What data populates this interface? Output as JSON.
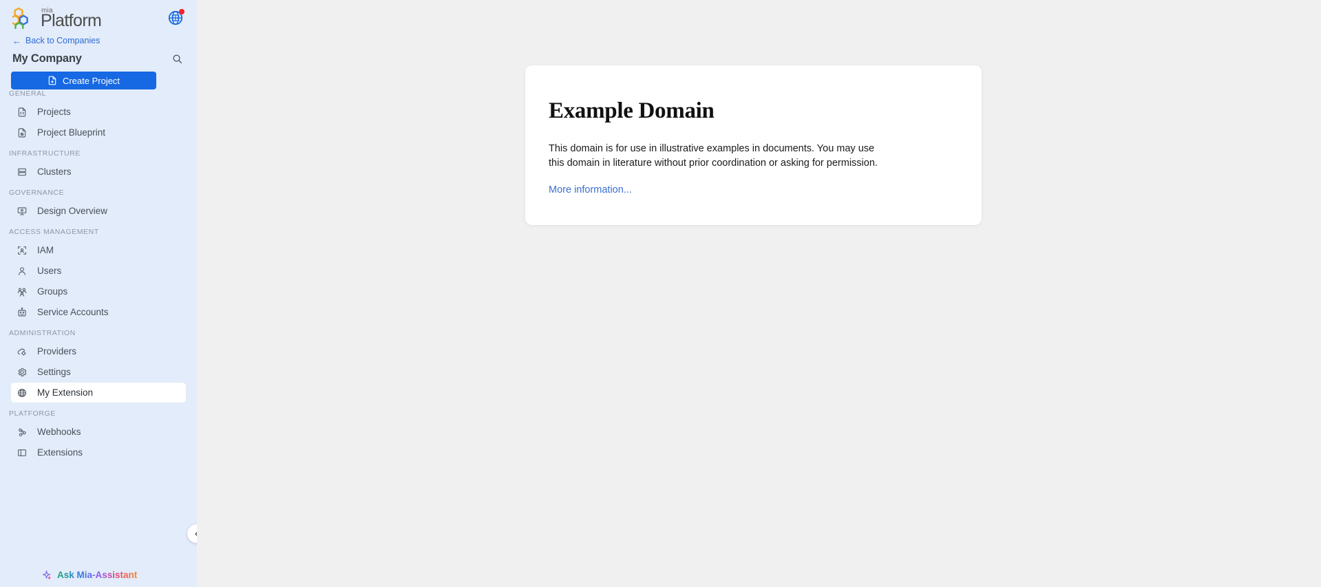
{
  "brand": {
    "name_small": "mia",
    "name_large": "Platform",
    "logo_colors": [
      "#f5a623",
      "#3b6fd4",
      "#4caf50",
      "#e05a2b"
    ],
    "accent_color": "#1668e3",
    "sidebar_bg": "#e2ecfa",
    "main_bg": "#f0f0f0"
  },
  "topbar": {
    "globe_icon": "globe-grid-icon",
    "notification_dot_color": "#f5222d"
  },
  "sidebar": {
    "back_link": "Back to Companies",
    "back_icon": "arrow-left-icon",
    "company_name": "My Company",
    "search_icon": "search-icon",
    "create_project_label": "Create Project",
    "create_project_icon": "file-plus-icon",
    "collapse_icon": "chevron-left-icon",
    "assistant": {
      "label": "Ask Mia-Assistant",
      "icon": "sparkle-icon"
    },
    "groups": [
      {
        "label": "GENERAL",
        "items": [
          {
            "label": "Projects",
            "icon": "code-file-icon",
            "selected": false
          },
          {
            "label": "Project Blueprint",
            "icon": "blueprint-icon",
            "selected": false
          }
        ]
      },
      {
        "label": "INFRASTRUCTURE",
        "items": [
          {
            "label": "Clusters",
            "icon": "server-icon",
            "selected": false
          }
        ]
      },
      {
        "label": "GOVERNANCE",
        "items": [
          {
            "label": "Design Overview",
            "icon": "presentation-icon",
            "selected": false
          }
        ]
      },
      {
        "label": "ACCESS MANAGEMENT",
        "items": [
          {
            "label": "IAM",
            "icon": "user-scan-icon",
            "selected": false
          },
          {
            "label": "Users",
            "icon": "user-icon",
            "selected": false
          },
          {
            "label": "Groups",
            "icon": "users-group-icon",
            "selected": false
          },
          {
            "label": "Service Accounts",
            "icon": "robot-icon",
            "selected": false
          }
        ]
      },
      {
        "label": "ADMINISTRATION",
        "items": [
          {
            "label": "Providers",
            "icon": "cloud-gear-icon",
            "selected": false
          },
          {
            "label": "Settings",
            "icon": "gear-icon",
            "selected": false
          },
          {
            "label": "My Extension",
            "icon": "globe-icon",
            "selected": true
          }
        ]
      },
      {
        "label": "PLATFORGE",
        "items": [
          {
            "label": "Webhooks",
            "icon": "webhook-icon",
            "selected": false
          },
          {
            "label": "Extensions",
            "icon": "panel-icon",
            "selected": false
          }
        ]
      }
    ]
  },
  "main": {
    "card": {
      "title": "Example Domain",
      "body": "This domain is for use in illustrative examples in documents. You may use this domain in literature without prior coordination or asking for permission.",
      "link": "More information..."
    }
  }
}
